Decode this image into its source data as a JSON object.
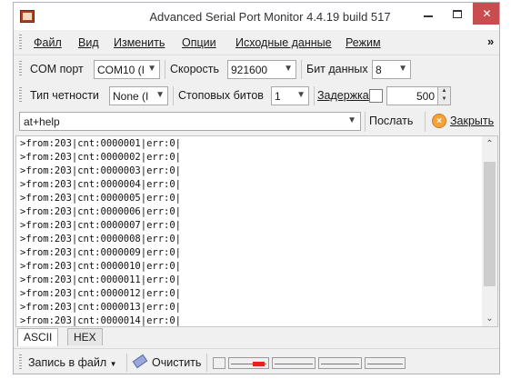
{
  "window": {
    "title": "Advanced Serial Port Monitor 4.4.19 build 517",
    "close_glyph": "✕",
    "icons": {
      "app": "app-icon",
      "minimize": "minimize-icon",
      "maximize": "maximize-icon",
      "close": "close-icon"
    }
  },
  "menu": {
    "items": [
      "Файл",
      "Вид",
      "Изменить",
      "Опции",
      "Исходные данные",
      "Режим"
    ],
    "more": "»"
  },
  "toolbar1": {
    "com_port_label": "COM порт",
    "com_port_value": "COM10 (I",
    "speed_label": "Скорость",
    "speed_value": "921600",
    "data_bits_label": "Бит данных",
    "data_bits_value": "8"
  },
  "toolbar2": {
    "parity_label": "Тип четности",
    "parity_value": "None (I",
    "stop_bits_label": "Стоповых битов",
    "stop_bits_value": "1",
    "delay_label": "Задержка",
    "delay_checked": false,
    "delay_value": "500"
  },
  "command": {
    "value": "at+help",
    "send_label": "Послать",
    "close_label": "Закрыть"
  },
  "output": {
    "lines": [
      ">from:203|cnt:0000001|err:0|",
      ">from:203|cnt:0000002|err:0|",
      ">from:203|cnt:0000003|err:0|",
      ">from:203|cnt:0000004|err:0|",
      ">from:203|cnt:0000005|err:0|",
      ">from:203|cnt:0000006|err:0|",
      ">from:203|cnt:0000007|err:0|",
      ">from:203|cnt:0000008|err:0|",
      ">from:203|cnt:0000009|err:0|",
      ">from:203|cnt:0000010|err:0|",
      ">from:203|cnt:0000011|err:0|",
      ">from:203|cnt:0000012|err:0|",
      ">from:203|cnt:0000013|err:0|",
      ">from:203|cnt:0000014|err:0|"
    ]
  },
  "tabs": [
    {
      "label": "ASCII",
      "active": true
    },
    {
      "label": "HEX",
      "active": false
    }
  ],
  "bottom": {
    "save_label": "Запись в файл",
    "clear_label": "Очистить"
  },
  "colors": {
    "close_button": "#c74d50",
    "window_bg": "#f0f0f0",
    "signal_active": "#e3241b",
    "close_icon": "#f4a33a"
  }
}
